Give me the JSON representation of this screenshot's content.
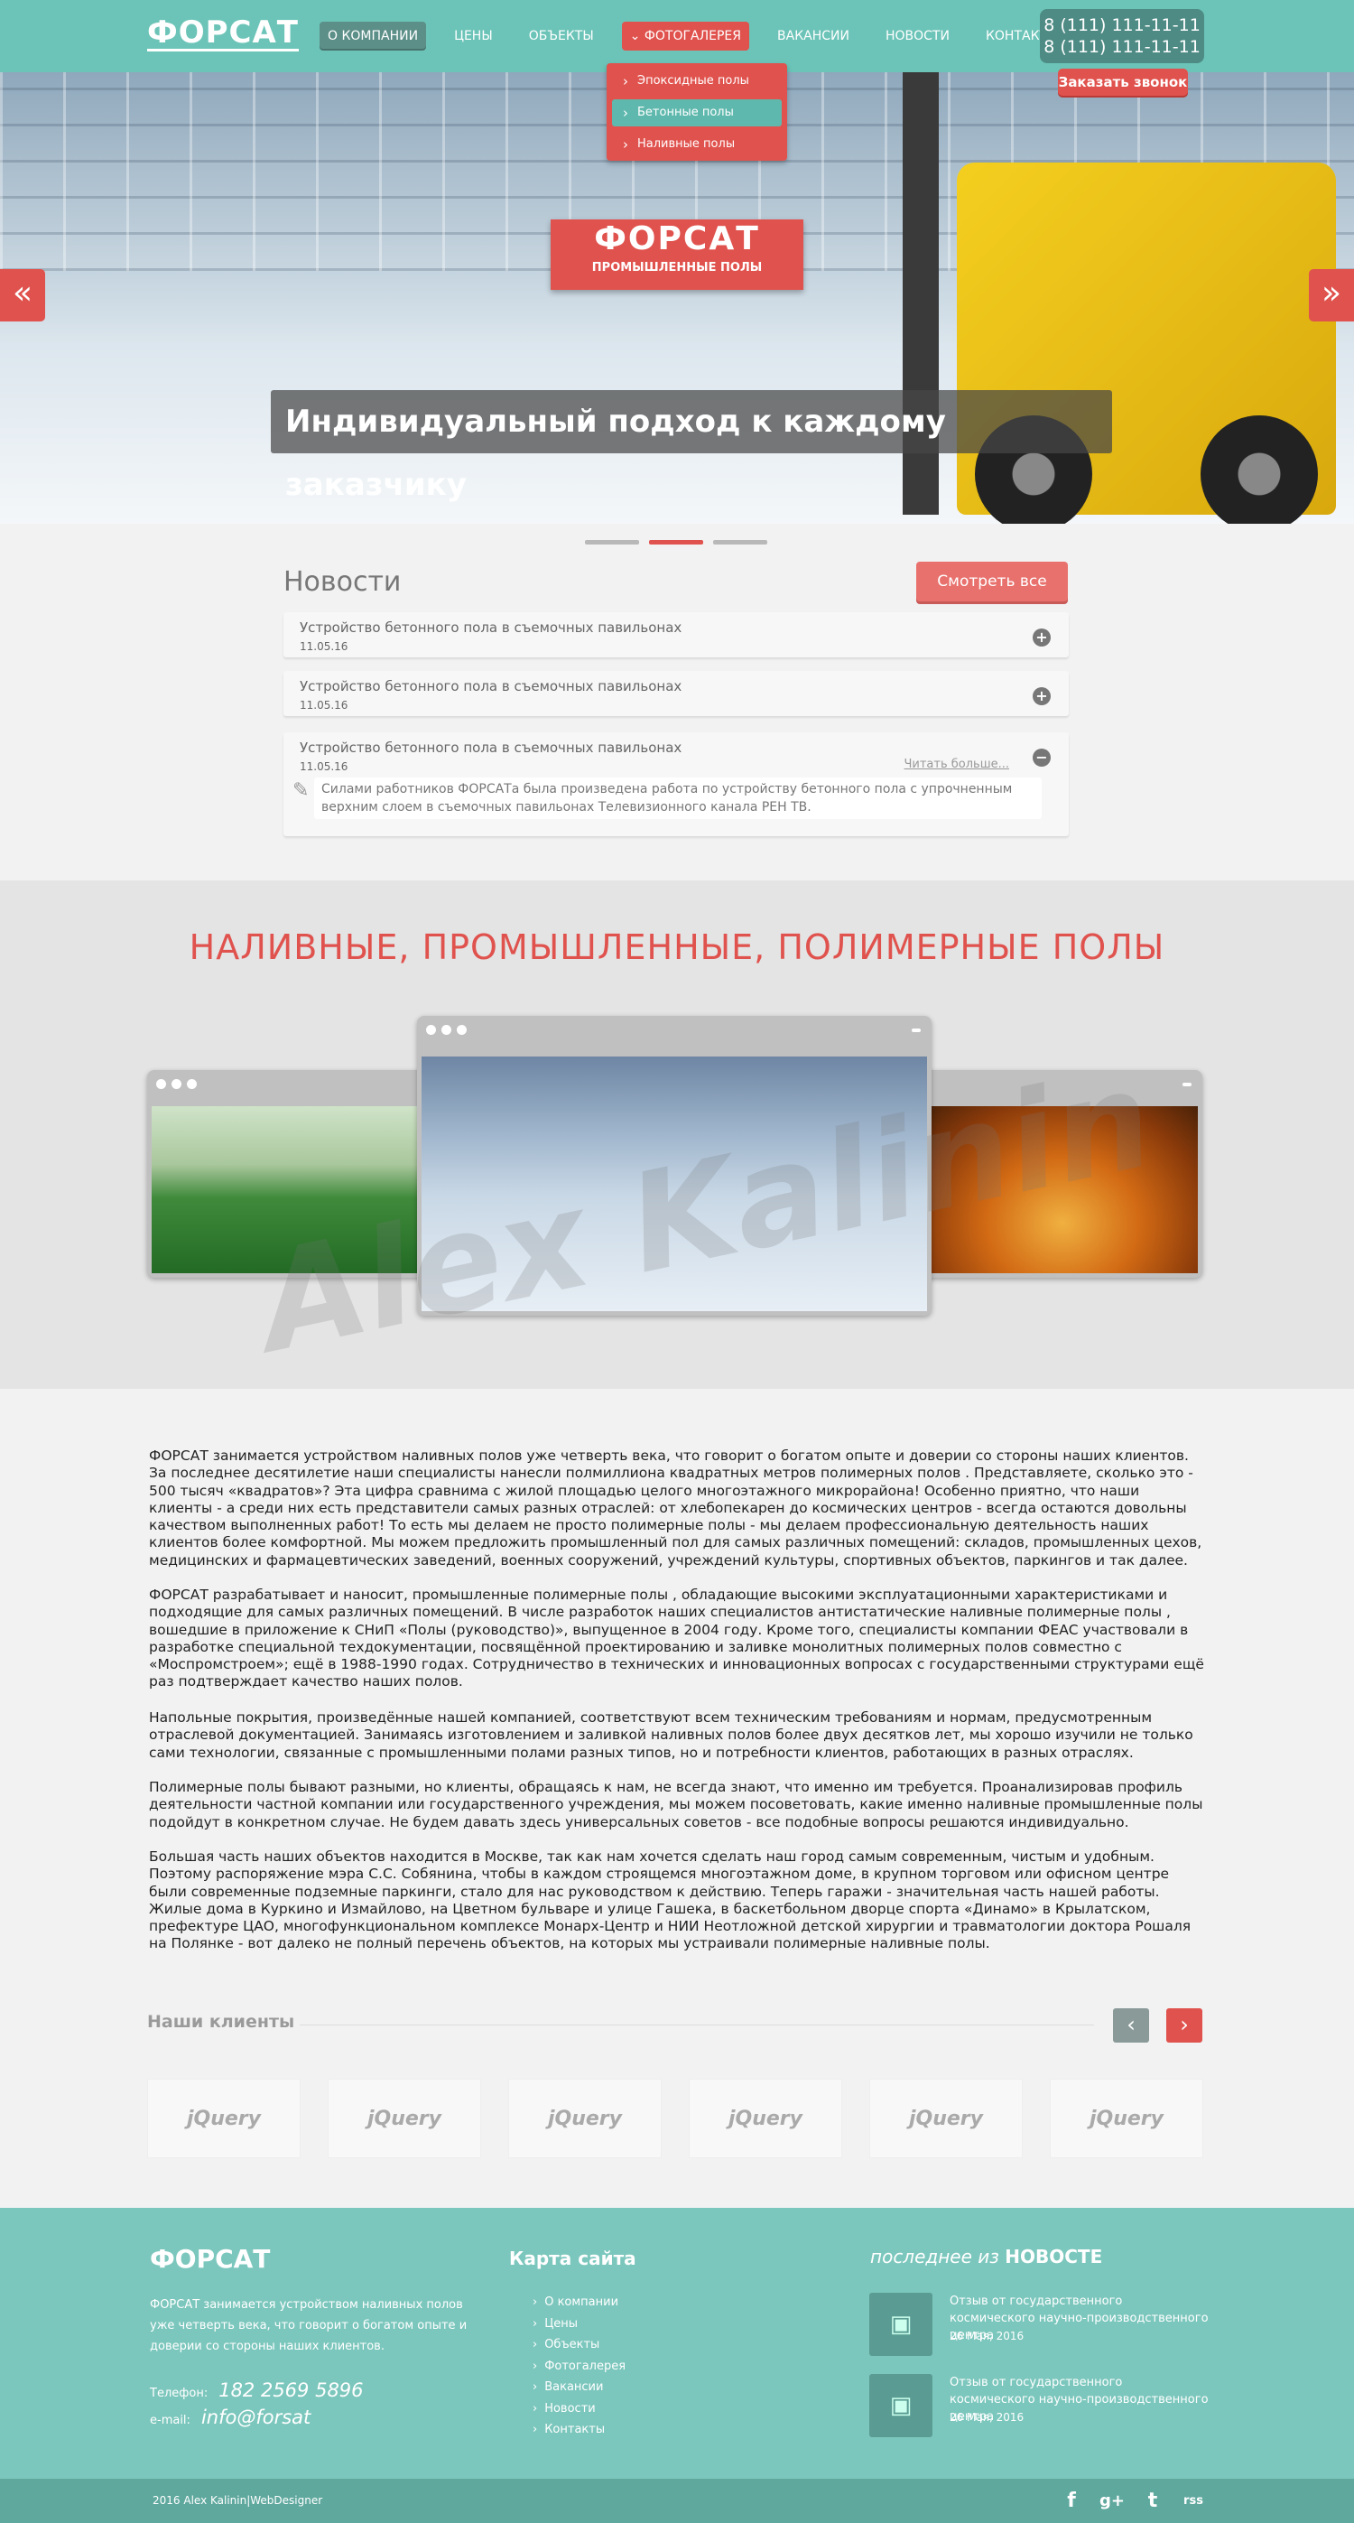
{
  "header": {
    "logo": "ФОРСАТ",
    "nav": [
      "О КОМПАНИИ",
      "ЦЕНЫ",
      "ОБЪЕКТЫ",
      "ФОТОГАЛЕРЕЯ",
      "ВАКАНСИИ",
      "НОВОСТИ",
      "КОНТАКТЫ"
    ],
    "phone1": "8 (111) 111-11-11",
    "phone2": "8 (111) 111-11-11",
    "call_button": "Заказать звонок",
    "dropdown": [
      "Эпоксидные полы",
      "Бетонные полы",
      "Наливные полы"
    ]
  },
  "hero": {
    "logo_title": "ФОРСАТ",
    "logo_subtitle": "ПРОМЫШЛЕННЫЕ ПОЛЫ",
    "caption": "Индивидуальный подход к каждому заказчику",
    "prev_icon": "«",
    "next_icon": "»"
  },
  "news": {
    "title": "Новости",
    "all_button": "Смотреть все",
    "items": [
      {
        "title": "Устройство бетонного пола в съемочных павильонах",
        "date": "11.05.16",
        "toggle": "+"
      },
      {
        "title": "Устройство бетонного пола в съемочных павильонах",
        "date": "11.05.16",
        "toggle": "+"
      },
      {
        "title": "Устройство бетонного пола в съемочных павильонах",
        "date": "11.05.16",
        "toggle": "−",
        "more": "Читать больше...",
        "body": "Силами работников ФОРСАТа была произведена работа по устройству бетонного пола с упрочненным верхним слоем в съемочных павильонах Телевизионного канала РЕН ТВ."
      }
    ]
  },
  "gallery": {
    "title": "НАЛИВНЫЕ, ПРОМЫШЛЕННЫЕ, ПОЛИМЕРНЫЕ ПОЛЫ",
    "watermark": "Alex Kalinin"
  },
  "about": {
    "p1": "ФОРСАТ занимается устройством наливных полов уже четверть века, что говорит о богатом опыте и доверии со стороны наших клиентов. За последнее десятилетие наши специалисты нанесли полмиллиона квадратных метров полимерных полов . Представляете, сколько это - 500 тысяч «квадратов»? Эта цифра сравнима с жилой площадью целого многоэтажного микрорайона! Особенно приятно, что наши клиенты - а среди них есть представители самых разных отраслей: от хлебопекарен до космических центров - всегда остаются довольны качеством выполненных работ! То есть мы делаем не просто полимерные полы - мы делаем профессиональную деятельность наших клиентов более комфортной. Мы можем предложить промышленный пол для самых различных помещений: складов, промышленных цехов, медицинских и фармацевтических заведений, военных сооружений, учреждений культуры, спортивных объектов, паркингов и так далее.",
    "p2": "ФОРСАТ разрабатывает и наносит, промышленные полимерные полы , обладающие высокими эксплуатационными характеристиками и подходящие для самых различных помещений. В числе разработок наших специалистов антистатические наливные полимерные полы , вошедшие в приложение к СНиП «Полы (руководство)», выпущенное в 2004 году. Кроме того, специалисты компании ФЕАС участвовали в разработке специальной техдокументации, посвящённой проектированию и заливке монолитных полимерных полов совместно с «Моспромстроем»; ещё в 1988-1990 годах. Сотрудничество в технических и инновационных вопросах с государственными структурами ещё раз подтверждает качество наших полов.",
    "p3": "Напольные покрытия, произведённые нашей компанией, соответствуют всем техническим требованиям и нормам, предусмотренным отраслевой документацией. Занимаясь изготовлением и заливкой наливных полов более двух десятков лет, мы хорошо изучили не только сами технологии, связанные с промышленными полами разных типов, но и потребности клиентов, работающих в разных отраслях.",
    "p4": "Полимерные полы бывают разными, но клиенты, обращаясь к нам, не всегда знают, что именно им требуется. Проанализировав профиль деятельности частной компании или государственного учреждения, мы можем посоветовать, какие именно наливные промышленные полы подойдут в конкретном случае. Не будем давать здесь универсальных советов - все подобные вопросы решаются индивидуально.",
    "p5": "Большая часть наших объектов находится в Москве, так как нам хочется сделать наш город самым современным, чистым и удобным. Поэтому распоряжение мэра С.С. Собянина, чтобы в каждом строящемся многоэтажном доме, в крупном торговом или офисном центре были современные подземные паркинги, стало для нас руководством к действию. Теперь гаражи - значительная часть нашей работы. Жилые дома в Куркино и Измайлово, на Цветном бульваре и улице Гашека, в баскетбольном дворце спорта «Динамо» в Крылатском, префектуре ЦАО, многофункциональном комплексе Монарх-Центр и НИИ Неотложной детской хирургии и травматологии доктора Рошаля на Полянке - вот далеко не полный перечень объектов, на которых мы устраивали полимерные наливные полы."
  },
  "clients": {
    "title": "Наши клиенты",
    "prev": "‹",
    "next": "›",
    "logos": [
      "jQuery",
      "jQuery",
      "jQuery",
      "jQuery",
      "jQuery",
      "jQuery"
    ]
  },
  "footer": {
    "logo": "ФОРСАТ",
    "desc": "ФОРСАТ занимается устройством наливных полов уже четверть века, что говорит о богатом опыте и доверии со стороны наших клиентов.",
    "phone_label": "Телефон:",
    "phone": "182 2569 5896",
    "email_label": "e-mail:",
    "email": "info@forsat",
    "sitemap_title": "Карта сайта",
    "sitemap": [
      "О компании",
      "Цены",
      "Объекты",
      "Фотогалерея",
      "Вакансии",
      "Новости",
      "Контакты"
    ],
    "news_prefix": "последнее из",
    "news_title": "НОВОСТЕ",
    "news": [
      {
        "title": "Отзыв от государственного космического научно-производственного центра",
        "date": "26 Мая, 2016"
      },
      {
        "title": "Отзыв от государственного космического научно-производственного центра",
        "date": "26 Мая, 2016"
      }
    ],
    "copyright": "2016 Alex Kalinin|WebDesigner",
    "social": [
      "f",
      "g+",
      "t",
      "rss"
    ]
  },
  "colors": {
    "accent": "#e0524d",
    "teal": "#6cc4b8",
    "dark_teal": "#4e8b84"
  }
}
